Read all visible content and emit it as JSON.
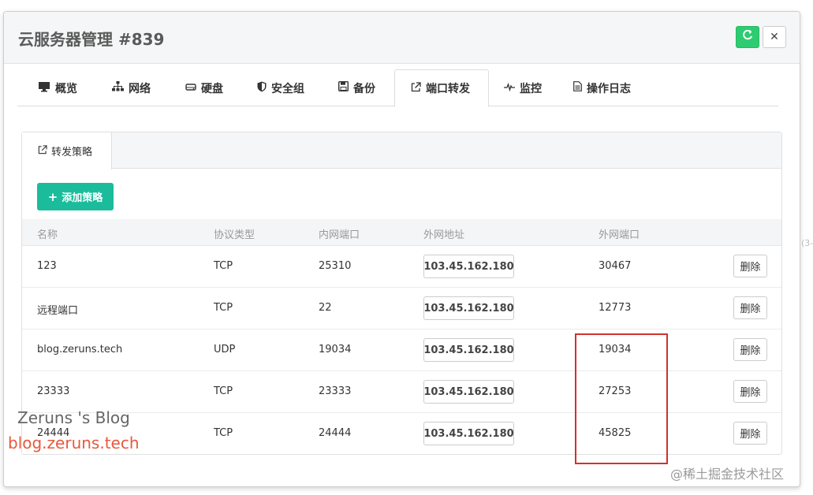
{
  "modal": {
    "title": "云服务器管理 #839",
    "refresh_icon": "refresh-icon",
    "close_label": "✕"
  },
  "tabs": [
    {
      "label": "概览",
      "icon": "monitor-icon"
    },
    {
      "label": "网络",
      "icon": "sitemap-icon"
    },
    {
      "label": "硬盘",
      "icon": "hdd-icon"
    },
    {
      "label": "安全组",
      "icon": "shield-icon"
    },
    {
      "label": "备份",
      "icon": "save-icon"
    },
    {
      "label": "端口转发",
      "icon": "external-link-icon",
      "active": true
    },
    {
      "label": "监控",
      "icon": "pulse-icon"
    },
    {
      "label": "操作日志",
      "icon": "file-text-icon"
    }
  ],
  "subtab": {
    "label": "转发策略",
    "icon": "external-link-icon"
  },
  "add_button": {
    "label": "添加策略"
  },
  "table": {
    "headers": [
      "名称",
      "协议类型",
      "内网端口",
      "外网地址",
      "外网端口"
    ],
    "rows": [
      {
        "name": "123",
        "protocol": "TCP",
        "internal_port": "25310",
        "external_ip": "103.45.162.180",
        "external_port": "30467",
        "action": "删除"
      },
      {
        "name": "远程端口",
        "protocol": "TCP",
        "internal_port": "22",
        "external_ip": "103.45.162.180",
        "external_port": "12773",
        "action": "删除"
      },
      {
        "name": "blog.zeruns.tech",
        "protocol": "UDP",
        "internal_port": "19034",
        "external_ip": "103.45.162.180",
        "external_port": "19034",
        "action": "删除"
      },
      {
        "name": "23333",
        "protocol": "TCP",
        "internal_port": "23333",
        "external_ip": "103.45.162.180",
        "external_port": "27253",
        "action": "删除"
      },
      {
        "name": "24444",
        "protocol": "TCP",
        "internal_port": "24444",
        "external_ip": "103.45.162.180",
        "external_port": "45825",
        "action": "删除"
      }
    ]
  },
  "watermarks": {
    "blog_name": "Zeruns 's Blog",
    "blog_url": "blog.zeruns.tech",
    "juejin": "@稀土掘金技术社区"
  },
  "edge_text": "(3-",
  "colors": {
    "refresh_green": "#2ecc71",
    "add_button_teal": "#1abc9c",
    "highlight_red": "#d0312d"
  }
}
